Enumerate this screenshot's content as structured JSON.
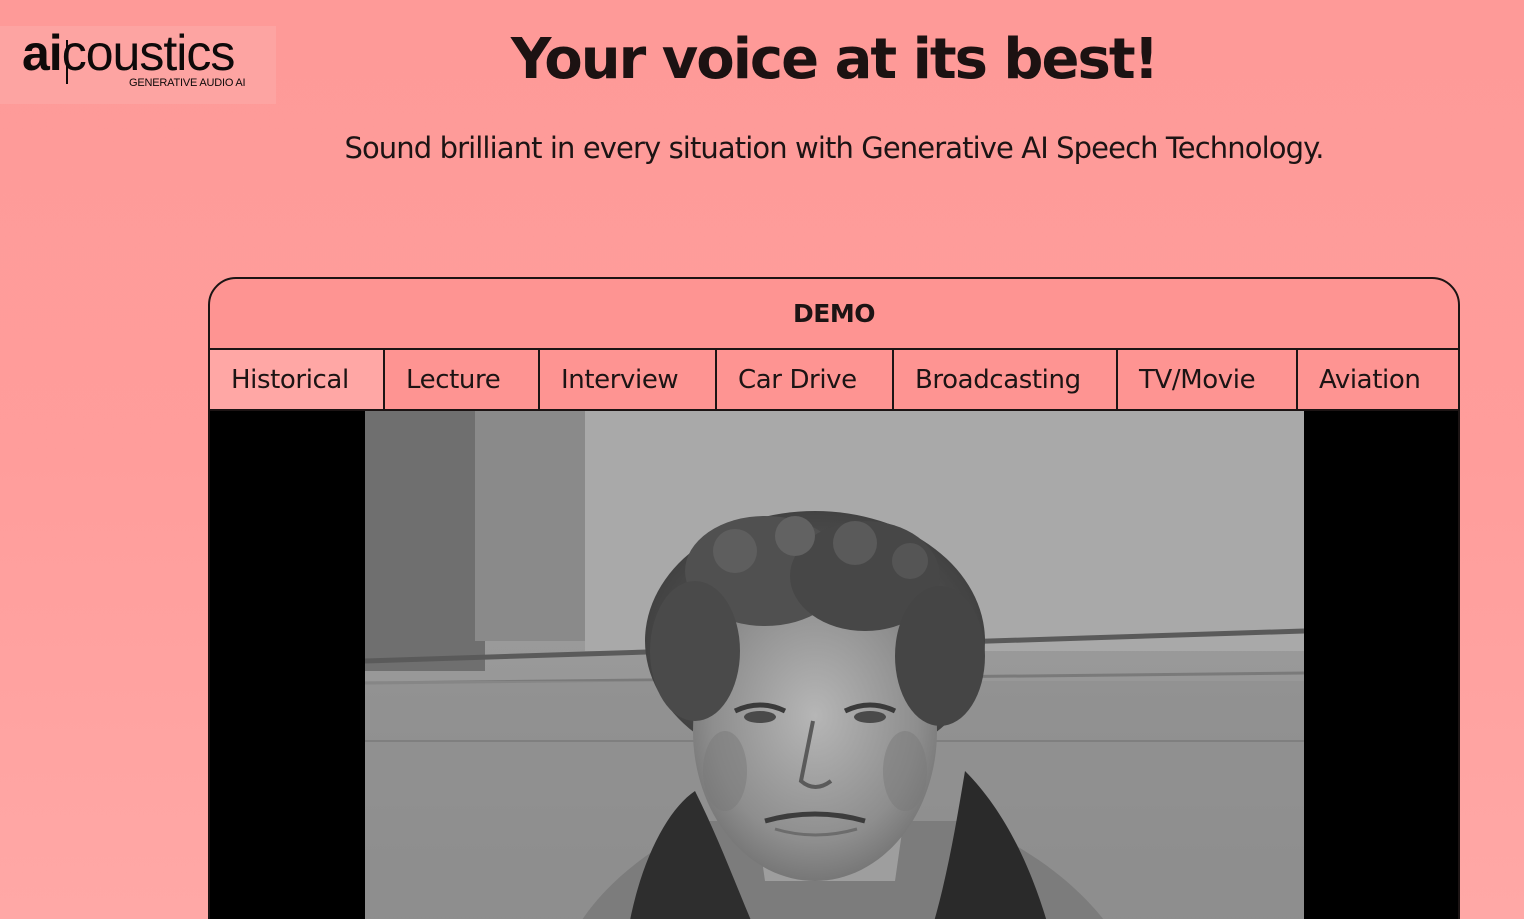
{
  "logo": {
    "wordmark_bold": "ai",
    "wordmark_rest": "coustics",
    "tagline": "GENERATIVE AUDIO AI"
  },
  "hero": {
    "title": "Your voice at its best!",
    "subtitle": "Sound brilliant in every situation with Generative AI Speech Technology."
  },
  "demo": {
    "header": "DEMO",
    "tabs": [
      {
        "label": "Historical",
        "active": true
      },
      {
        "label": "Lecture",
        "active": false
      },
      {
        "label": "Interview",
        "active": false
      },
      {
        "label": "Car Drive",
        "active": false
      },
      {
        "label": "Broadcasting",
        "active": false
      },
      {
        "label": "TV/Movie",
        "active": false
      },
      {
        "label": "Aviation",
        "active": false
      }
    ]
  },
  "colors": {
    "background": "#fe9a98",
    "panel": "#fe9492",
    "active_tab": "#ffa7a5",
    "text": "#1c1414",
    "video_letterbox": "#000000"
  },
  "icons": {
    "video_content": "historical-footage-woman-portrait"
  }
}
